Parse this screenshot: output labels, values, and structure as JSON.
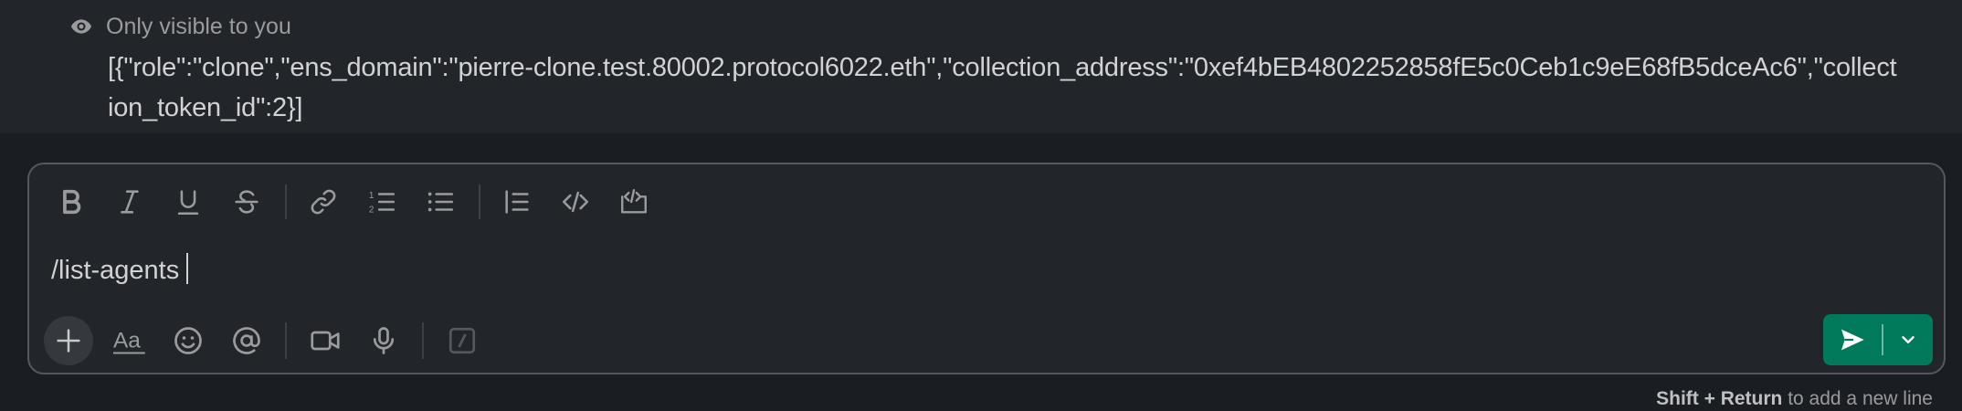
{
  "message": {
    "visibility_label": "Only visible to you",
    "body": "[{\"role\":\"clone\",\"ens_domain\":\"pierre-clone.test.80002.protocol6022.eth\",\"collection_address\":\"0xef4bEB4802252858fE5c0Ceb1c9eE68fB5dceAc6\",\"collection_token_id\":2}]"
  },
  "composer": {
    "input_value": "/list-agents",
    "toolbar": [
      "bold-icon",
      "italic-icon",
      "underline-icon",
      "strikethrough-icon",
      "link-icon",
      "ordered-list-icon",
      "bulleted-list-icon",
      "blockquote-icon",
      "code-icon",
      "code-block-icon"
    ],
    "bottom_actions": [
      "plus-icon",
      "formatting-icon",
      "emoji-icon",
      "mention-icon",
      "video-icon",
      "microphone-icon",
      "slash-command-icon"
    ],
    "send_color": "#007a5a"
  },
  "hint": {
    "keys": "Shift + Return",
    "text": " to add a new line"
  }
}
